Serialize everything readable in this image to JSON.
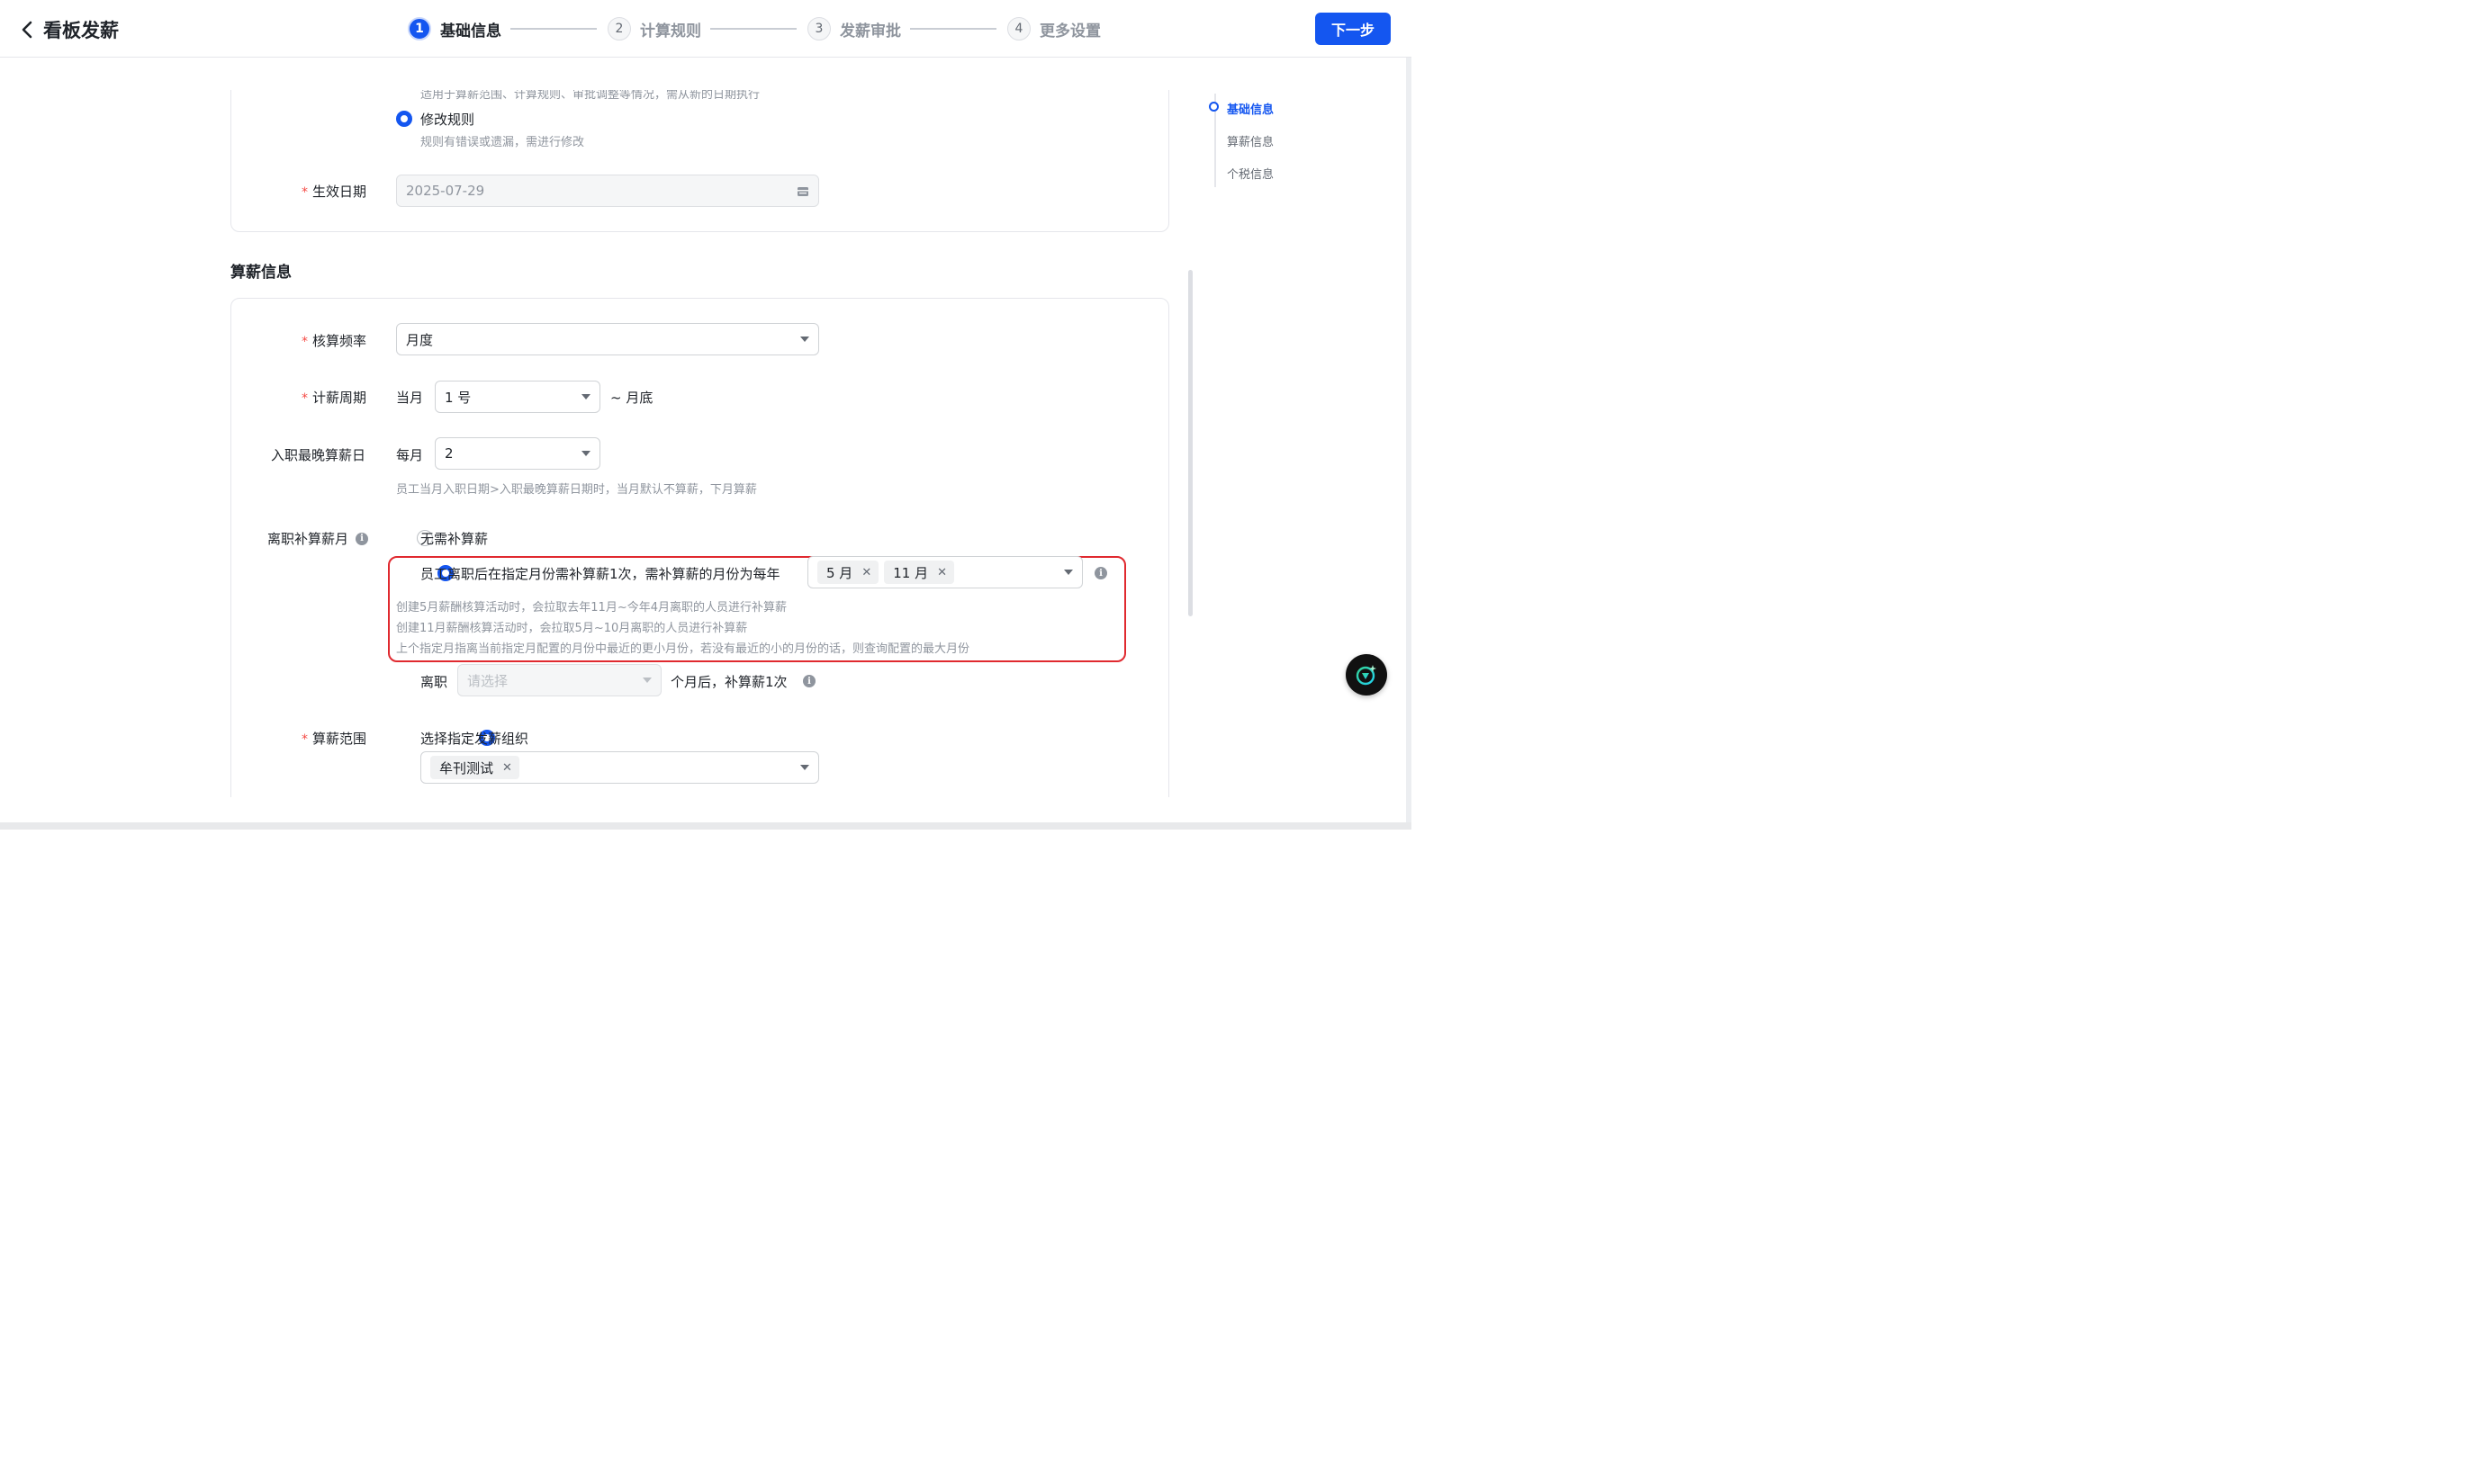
{
  "header": {
    "title": "看板发薪",
    "next_label": "下一步",
    "steps": [
      {
        "num": "1",
        "label": "基础信息"
      },
      {
        "num": "2",
        "label": "计算规则"
      },
      {
        "num": "3",
        "label": "发薪审批"
      },
      {
        "num": "4",
        "label": "更多设置"
      }
    ]
  },
  "basic": {
    "cut_hint": "适用于算薪范围、计算规则、审批调整等情况，需从新的日期执行",
    "modify_rule_label": "修改规则",
    "modify_rule_hint": "规则有错误或遗漏，需进行修改",
    "effective_date_label": "生效日期",
    "effective_date_value": "2025-07-29"
  },
  "salary": {
    "section_title": "算薪信息",
    "frequency_label": "核算频率",
    "frequency_value": "月度",
    "period_label": "计薪周期",
    "period_prefix": "当月",
    "period_value": "1 号",
    "period_suffix": "~ 月底",
    "latest_day_label": "入职最晚算薪日",
    "latest_day_prefix": "每月",
    "latest_day_value": "2",
    "latest_day_hint": "员工当月入职日期>入职最晚算薪日期时，当月默认不算薪，下月算薪",
    "resign_label": "离职补算薪月",
    "resign_opt_none": "无需补算薪",
    "resign_opt_month": "员工离职后在指定月份需补算薪1次，需补算薪的月份为每年",
    "resign_months": [
      "5 月",
      "11 月"
    ],
    "resign_hint_1": "创建5月薪酬核算活动时，会拉取去年11月~今年4月离职的人员进行补算薪",
    "resign_hint_2": "创建11月薪酬核算活动时，会拉取5月~10月离职的人员进行补算薪",
    "resign_hint_3": "上个指定月指离当前指定月配置的月份中最近的更小月份，若没有最近的小的月份的话，则查询配置的最大月份",
    "resign_opt_after_prefix": "离职",
    "resign_opt_after_placeholder": "请选择",
    "resign_opt_after_suffix": "个月后，补算薪1次",
    "scope_label": "算薪范围",
    "scope_opt_org": "选择指定发薪组织",
    "scope_orgs": [
      "牟刊测试"
    ]
  },
  "anchor_nav": {
    "items": [
      "基础信息",
      "算薪信息",
      "个税信息"
    ]
  },
  "colors": {
    "primary": "#1456f0",
    "required": "#f54a45",
    "highlight_border": "#e0292f"
  }
}
